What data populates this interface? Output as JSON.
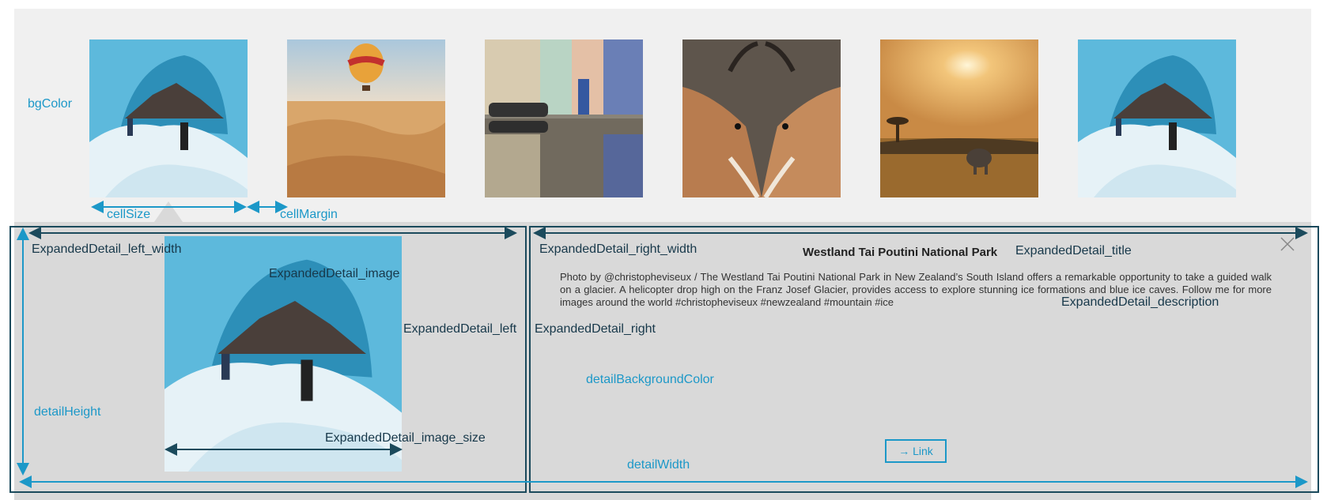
{
  "annotations": {
    "bgColor": "bgColor",
    "cellSize": "cellSize",
    "cellMargin": "cellMargin",
    "left_width": "ExpandedDetail_left_width",
    "right_width": "ExpandedDetail_right_width",
    "title_ann": "ExpandedDetail_title",
    "image_ann": "ExpandedDetail_image",
    "left_ann": "ExpandedDetail_left",
    "right_ann": "ExpandedDetail_right",
    "description_ann": "ExpandedDetail_description",
    "detailBackgroundColor": "detailBackgroundColor",
    "detailHeight": "detailHeight",
    "image_size_ann": "ExpandedDetail_image_size",
    "detailWidth": "detailWidth"
  },
  "detail": {
    "title": "Westland Tai Poutini National Park",
    "description": "Photo by @christopheviseux / The Westland Tai Poutini National Park in New Zealand’s South Island offers a remarkable opportunity to take a guided walk on a glacier. A helicopter drop high on the Franz Josef Glacier, provides access to explore stunning ice formations and blue ice caves. Follow me for more images around the world #christopheviseux #newzealand #mountain #ice",
    "link_label": "→ Link"
  },
  "gallery": {
    "thumbnails": [
      "glacier-cave",
      "hot-air-balloon-desert",
      "street-reflection",
      "gazelles",
      "savanna-sunset",
      "glacier-cave"
    ]
  },
  "colors": {
    "gallery_bg": "#f0f0f0",
    "detail_bg": "#d9d9d9",
    "annotation_cyan": "#1c98c8",
    "annotation_navy": "#1b4a5c"
  }
}
